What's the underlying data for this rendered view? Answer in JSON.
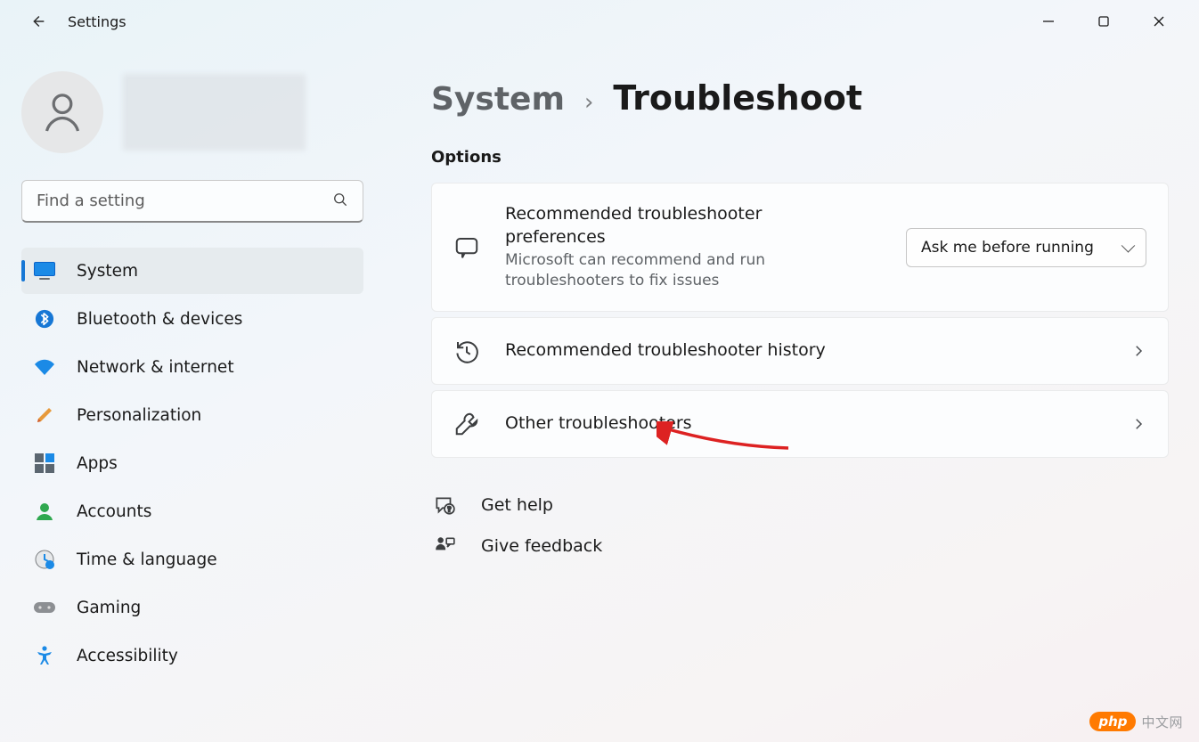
{
  "chrome": {
    "app_title": "Settings"
  },
  "search": {
    "placeholder": "Find a setting"
  },
  "sidebar": {
    "items": [
      {
        "label": "System"
      },
      {
        "label": "Bluetooth & devices"
      },
      {
        "label": "Network & internet"
      },
      {
        "label": "Personalization"
      },
      {
        "label": "Apps"
      },
      {
        "label": "Accounts"
      },
      {
        "label": "Time & language"
      },
      {
        "label": "Gaming"
      },
      {
        "label": "Accessibility"
      }
    ]
  },
  "breadcrumb": {
    "root": "System",
    "current": "Troubleshoot"
  },
  "section_label": "Options",
  "cards": {
    "recommended_prefs": {
      "title": "Recommended troubleshooter preferences",
      "subtitle": "Microsoft can recommend and run troubleshooters to fix issues",
      "dropdown_value": "Ask me before running"
    },
    "recommended_history": {
      "title": "Recommended troubleshooter history"
    },
    "other_troubleshooters": {
      "title": "Other troubleshooters"
    }
  },
  "links": {
    "help": "Get help",
    "feedback": "Give feedback"
  },
  "watermark": {
    "badge": "php",
    "text": "中文网"
  }
}
